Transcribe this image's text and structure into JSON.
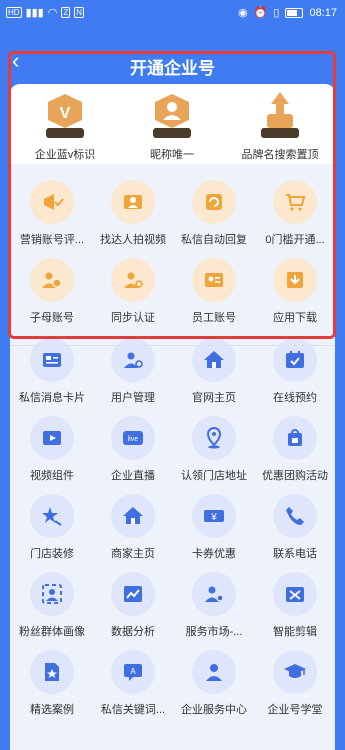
{
  "status": {
    "left": [
      "HD",
      "4G",
      "wifi",
      "Z",
      "N"
    ],
    "time": "08:17"
  },
  "nav": {
    "back": "‹",
    "title": "开通企业号"
  },
  "badges": [
    {
      "label": "企业蓝v标识",
      "icon": "blue-v-badge-icon"
    },
    {
      "label": "昵称唯一",
      "icon": "unique-nickname-badge-icon"
    },
    {
      "label": "品牌名搜索置顶",
      "icon": "search-top-badge-icon"
    }
  ],
  "highlighted": [
    {
      "label": "营销账号评...",
      "icon": "megaphone-check-icon"
    },
    {
      "label": "找达人拍视频",
      "icon": "video-person-icon"
    },
    {
      "label": "私信自动回复",
      "icon": "auto-reply-icon"
    },
    {
      "label": "0门槛开通...",
      "icon": "cart-icon"
    },
    {
      "label": "子母账号",
      "icon": "sub-account-icon"
    },
    {
      "label": "同步认证",
      "icon": "sync-certify-icon"
    },
    {
      "label": "员工账号",
      "icon": "employee-card-icon"
    },
    {
      "label": "应用下载",
      "icon": "download-icon"
    }
  ],
  "features": [
    {
      "label": "私信消息卡片",
      "icon": "message-card-icon"
    },
    {
      "label": "用户管理",
      "icon": "user-manage-icon"
    },
    {
      "label": "官网主页",
      "icon": "home-icon"
    },
    {
      "label": "在线预约",
      "icon": "calendar-check-icon"
    },
    {
      "label": "视频组件",
      "icon": "video-component-icon"
    },
    {
      "label": "企业直播",
      "icon": "live-icon"
    },
    {
      "label": "认领门店地址",
      "icon": "location-icon"
    },
    {
      "label": "优惠团购活动",
      "icon": "coupon-bag-icon"
    },
    {
      "label": "门店装修",
      "icon": "star-brush-icon"
    },
    {
      "label": "商家主页",
      "icon": "store-home-icon"
    },
    {
      "label": "卡券优惠",
      "icon": "yen-ticket-icon"
    },
    {
      "label": "联系电话",
      "icon": "phone-icon"
    },
    {
      "label": "粉丝群体画像",
      "icon": "fans-portrait-icon"
    },
    {
      "label": "数据分析",
      "icon": "chart-image-icon"
    },
    {
      "label": "服务市场-...",
      "icon": "service-market-icon"
    },
    {
      "label": "智能剪辑",
      "icon": "smart-edit-icon"
    },
    {
      "label": "精选案例",
      "icon": "featured-case-icon"
    },
    {
      "label": "私信关键词...",
      "icon": "keyword-reply-icon"
    },
    {
      "label": "企业服务中心",
      "icon": "service-center-icon"
    },
    {
      "label": "企业号学堂",
      "icon": "graduation-cap-icon"
    }
  ],
  "colors": {
    "brand": "#3f7cf2",
    "orange_icon": "#f0a43a",
    "blue_icon": "#3f6fe0",
    "highlight_box": "#e63c3c"
  }
}
